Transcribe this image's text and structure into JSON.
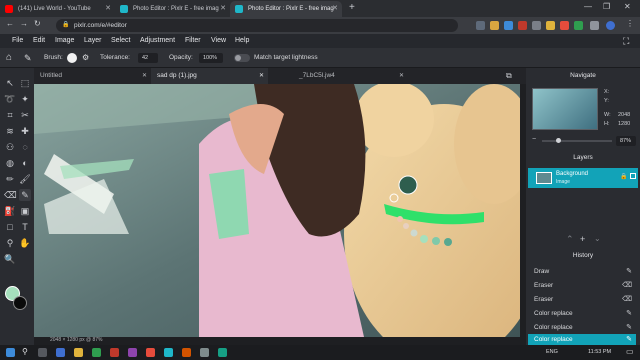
{
  "browser": {
    "tabs": [
      {
        "title": "(141) Live World - YouTube",
        "favicon_color": "#ff0000"
      },
      {
        "title": "Photo Editor : Pixlr E - free imag",
        "favicon_color": "#1fb7c9"
      },
      {
        "title": "Photo Editor : Pixlr E - free imag",
        "favicon_color": "#1fb7c9"
      }
    ],
    "url": "pixlr.com/e/#editor"
  },
  "menu": [
    "File",
    "Edit",
    "Image",
    "Layer",
    "Select",
    "Adjustment",
    "Filter",
    "View",
    "Help"
  ],
  "options": {
    "brush_label": "Brush:",
    "tolerance_label": "Tolerance:",
    "tolerance_value": "42",
    "opacity_label": "Opacity:",
    "opacity_value": "100%",
    "match_label": "Match target lightness"
  },
  "document_tabs": [
    "Untitled",
    "sad dp (1).jpg",
    "_7LbC5l.jw4"
  ],
  "status": "2048 × 1280 px @ 87%",
  "navigate": {
    "title": "Navigate",
    "x_label": "X:",
    "y_label": "Y:",
    "w_label": "W:",
    "w_value": "2048",
    "h_label": "H:",
    "h_value": "1280",
    "zoom": "87%"
  },
  "layers": {
    "title": "Layers",
    "items": [
      {
        "name": "Background",
        "type": "Image"
      }
    ]
  },
  "history": {
    "title": "History",
    "items": [
      "Draw",
      "Eraser",
      "Eraser",
      "Color replace",
      "Color replace",
      "Color replace"
    ],
    "selected_index": 5
  },
  "colors": {
    "accent": "#12a3b8",
    "foreground": "#a6e0bd",
    "background": "#0a0a0a",
    "replace_color": "#2fe06a"
  },
  "taskbar": {
    "time": "11:53 PM",
    "lang": "ENG"
  }
}
